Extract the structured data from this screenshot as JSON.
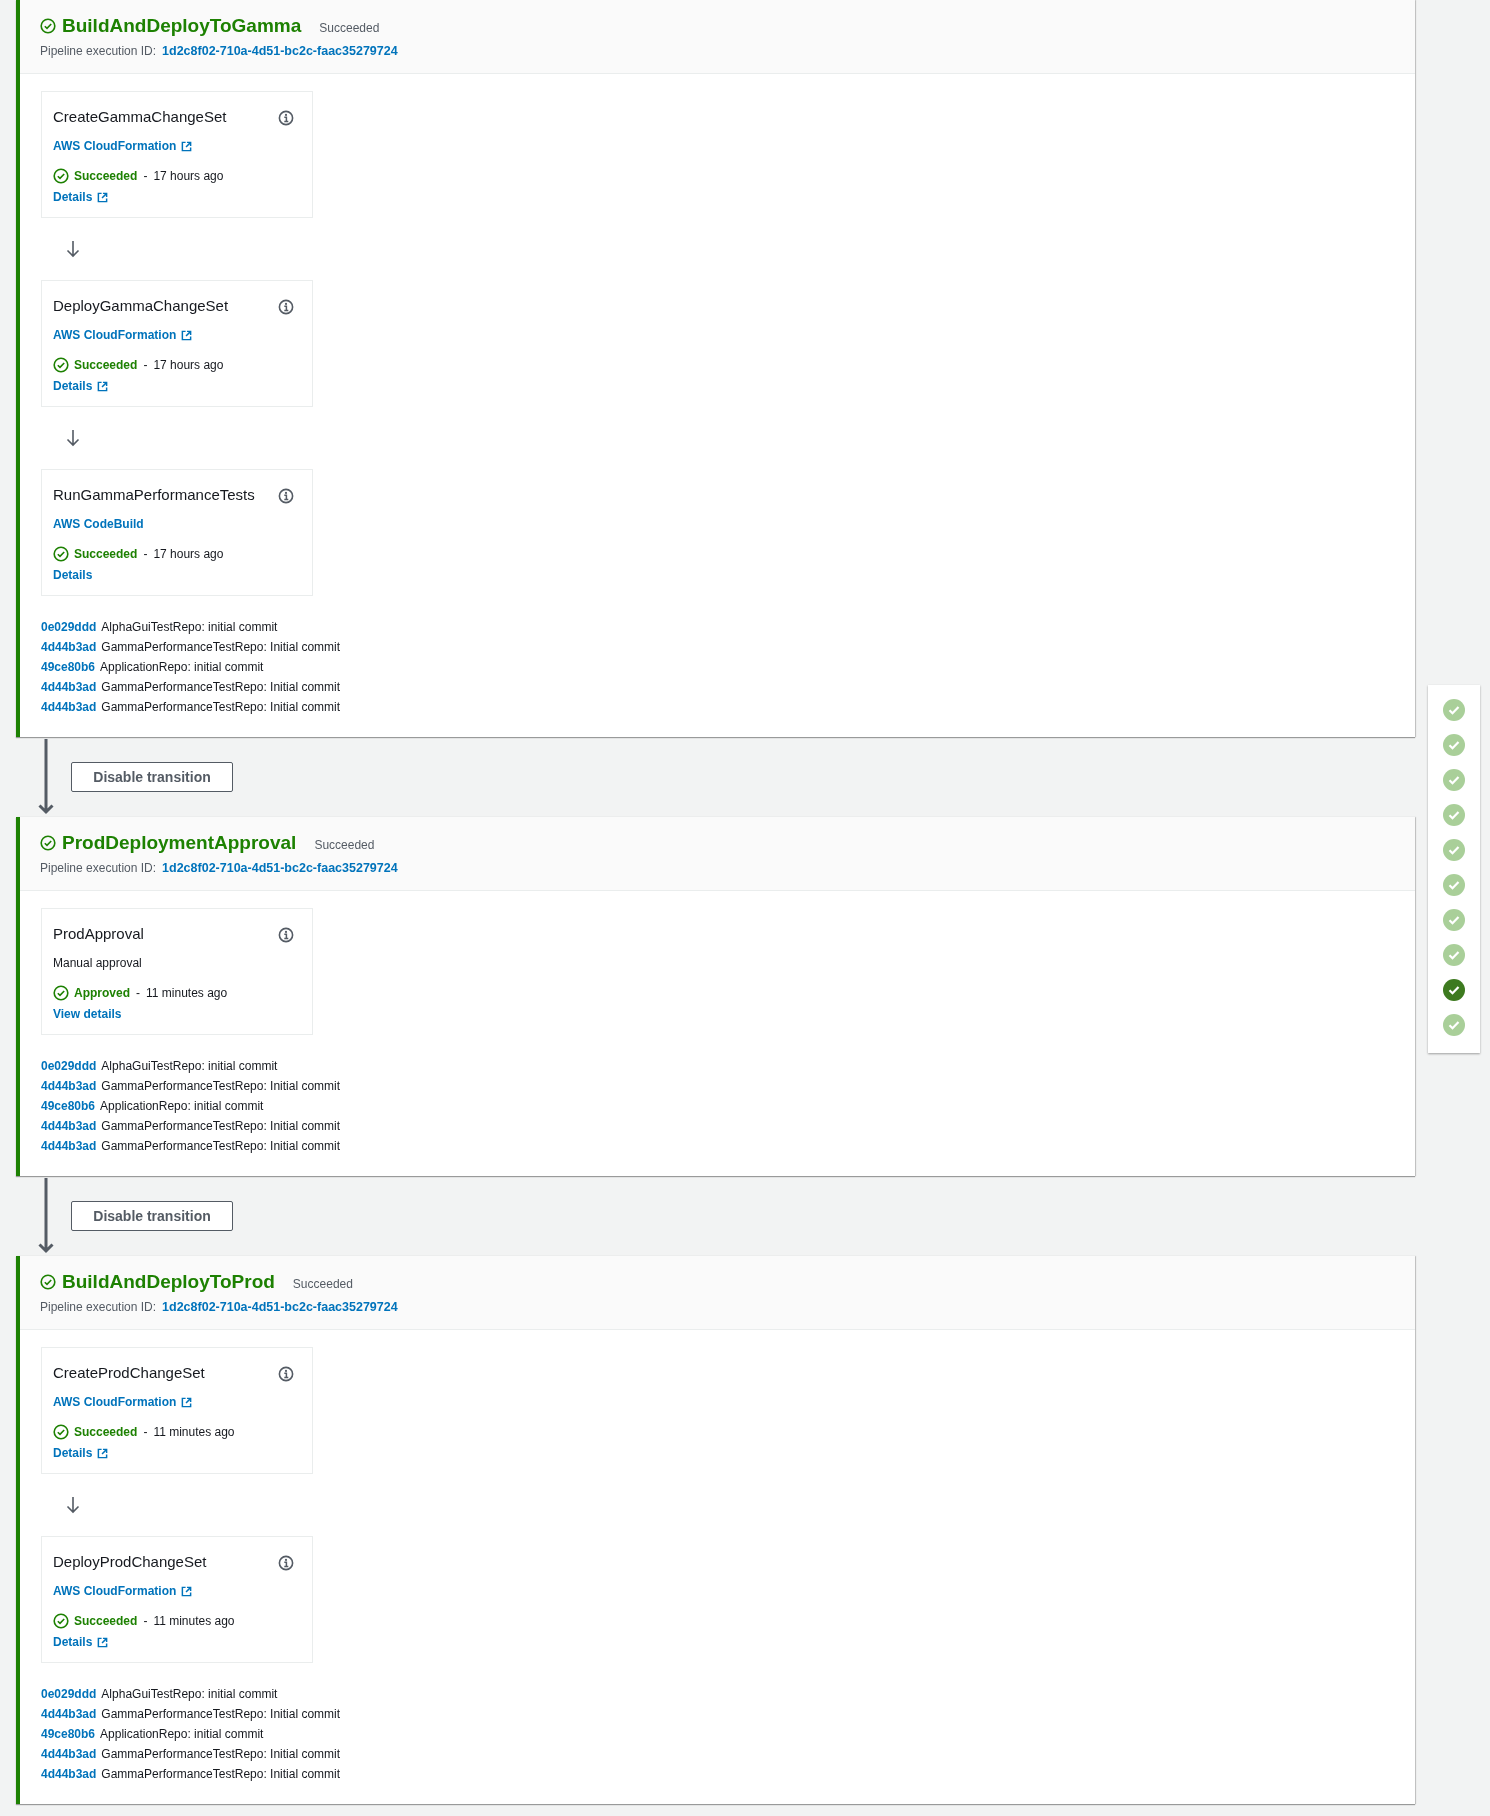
{
  "pipeline": [
    {
      "kind": "stage",
      "name": "BuildAndDeployToGamma",
      "status": "Succeeded",
      "execution_label": "Pipeline execution ID:",
      "execution_id": "1d2c8f02-710a-4d51-bc2c-faac35279724",
      "actions": [
        {
          "name": "CreateGammaChangeSet",
          "provider": "AWS CloudFormation",
          "provider_external": true,
          "status": "Succeeded",
          "separator": "-",
          "time": "17 hours ago",
          "link": "Details",
          "link_external": true
        },
        {
          "name": "DeployGammaChangeSet",
          "provider": "AWS CloudFormation",
          "provider_external": true,
          "status": "Succeeded",
          "separator": "-",
          "time": "17 hours ago",
          "link": "Details",
          "link_external": true
        },
        {
          "name": "RunGammaPerformanceTests",
          "provider": "AWS CodeBuild",
          "provider_external": false,
          "status": "Succeeded",
          "separator": "-",
          "time": "17 hours ago",
          "link": "Details",
          "link_external": false
        }
      ],
      "commits": [
        {
          "id": "0e029ddd",
          "message": "AlphaGuiTestRepo: initial commit"
        },
        {
          "id": "4d44b3ad",
          "message": "GammaPerformanceTestRepo: Initial commit"
        },
        {
          "id": "49ce80b6",
          "message": "ApplicationRepo: initial commit"
        },
        {
          "id": "4d44b3ad",
          "message": "GammaPerformanceTestRepo: Initial commit"
        },
        {
          "id": "4d44b3ad",
          "message": "GammaPerformanceTestRepo: Initial commit"
        }
      ]
    },
    {
      "kind": "transition",
      "button": "Disable transition"
    },
    {
      "kind": "stage",
      "name": "ProdDeploymentApproval",
      "status": "Succeeded",
      "execution_label": "Pipeline execution ID:",
      "execution_id": "1d2c8f02-710a-4d51-bc2c-faac35279724",
      "actions": [
        {
          "name": "ProdApproval",
          "provider": "Manual approval",
          "provider_plain": true,
          "status": "Approved",
          "separator": "-",
          "time": "11 minutes ago",
          "link": "View details",
          "link_external": false
        }
      ],
      "commits": [
        {
          "id": "0e029ddd",
          "message": "AlphaGuiTestRepo: initial commit"
        },
        {
          "id": "4d44b3ad",
          "message": "GammaPerformanceTestRepo: Initial commit"
        },
        {
          "id": "49ce80b6",
          "message": "ApplicationRepo: initial commit"
        },
        {
          "id": "4d44b3ad",
          "message": "GammaPerformanceTestRepo: Initial commit"
        },
        {
          "id": "4d44b3ad",
          "message": "GammaPerformanceTestRepo: Initial commit"
        }
      ]
    },
    {
      "kind": "transition",
      "button": "Disable transition"
    },
    {
      "kind": "stage",
      "name": "BuildAndDeployToProd",
      "status": "Succeeded",
      "execution_label": "Pipeline execution ID:",
      "execution_id": "1d2c8f02-710a-4d51-bc2c-faac35279724",
      "actions": [
        {
          "name": "CreateProdChangeSet",
          "provider": "AWS CloudFormation",
          "provider_external": true,
          "status": "Succeeded",
          "separator": "-",
          "time": "11 minutes ago",
          "link": "Details",
          "link_external": true
        },
        {
          "name": "DeployProdChangeSet",
          "provider": "AWS CloudFormation",
          "provider_external": true,
          "status": "Succeeded",
          "separator": "-",
          "time": "11 minutes ago",
          "link": "Details",
          "link_external": true
        }
      ],
      "commits": [
        {
          "id": "0e029ddd",
          "message": "AlphaGuiTestRepo: initial commit"
        },
        {
          "id": "4d44b3ad",
          "message": "GammaPerformanceTestRepo: Initial commit"
        },
        {
          "id": "49ce80b6",
          "message": "ApplicationRepo: initial commit"
        },
        {
          "id": "4d44b3ad",
          "message": "GammaPerformanceTestRepo: Initial commit"
        },
        {
          "id": "4d44b3ad",
          "message": "GammaPerformanceTestRepo: Initial commit"
        }
      ]
    }
  ],
  "stage_navigator": {
    "items": [
      {
        "selected": false
      },
      {
        "selected": false
      },
      {
        "selected": false
      },
      {
        "selected": false
      },
      {
        "selected": false
      },
      {
        "selected": false
      },
      {
        "selected": false
      },
      {
        "selected": false
      },
      {
        "selected": true
      },
      {
        "selected": false
      }
    ]
  }
}
